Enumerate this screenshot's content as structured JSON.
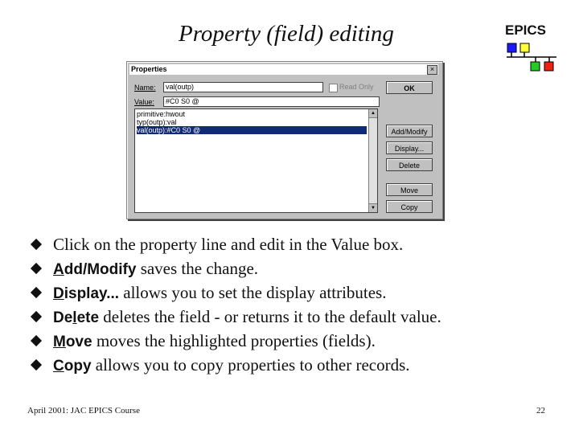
{
  "slide": {
    "title": "Property (field) editing",
    "logo_text": "EPICS",
    "footer_left": "April 2001: JAC EPICS Course",
    "page_number": "22"
  },
  "colors": {
    "logo_blue": "#1a1aff",
    "logo_yellow": "#ffff33",
    "logo_green": "#22cc22",
    "logo_red": "#ee2211",
    "selection": "#102a7a"
  },
  "dialog": {
    "title": "Properties",
    "close_glyph": "×",
    "name_label": "Name:",
    "name_value": "val(outp)",
    "readonly_label": "Read Only",
    "value_label": "Value:",
    "value_value": "#C0 S0 @",
    "list": [
      {
        "text": "primitive:hwout",
        "selected": false
      },
      {
        "text": "typ(outp):val",
        "selected": false
      },
      {
        "text": "val(outp):#C0 S0 @",
        "selected": true
      }
    ],
    "buttons": {
      "ok": "OK",
      "add_modify": "Add/Modify",
      "display": "Display...",
      "delete": "Delete",
      "move": "Move",
      "copy": "Copy"
    }
  },
  "bullets": [
    {
      "keyword": "",
      "ul_prefix": "",
      "ul_letter": "",
      "kw_rest": "",
      "text": "Click on the property line and edit in the Value box."
    },
    {
      "keyword": "Add/Modify",
      "ul_prefix": "",
      "ul_letter": "A",
      "kw_rest": "dd/Modify",
      "text": " saves the change."
    },
    {
      "keyword": "Display...",
      "ul_prefix": "",
      "ul_letter": "D",
      "kw_rest": "isplay...",
      "text": " allows you to set the display attributes."
    },
    {
      "keyword": "Delete",
      "ul_prefix": "De",
      "ul_letter": "l",
      "kw_rest": "ete",
      "text": " deletes the field - or returns it to the default value."
    },
    {
      "keyword": "Move",
      "ul_prefix": "",
      "ul_letter": "M",
      "kw_rest": "ove",
      "text": " moves the highlighted properties (fields)."
    },
    {
      "keyword": "Copy",
      "ul_prefix": "",
      "ul_letter": "C",
      "kw_rest": "opy",
      "text": " allows you to copy properties to other records."
    }
  ]
}
